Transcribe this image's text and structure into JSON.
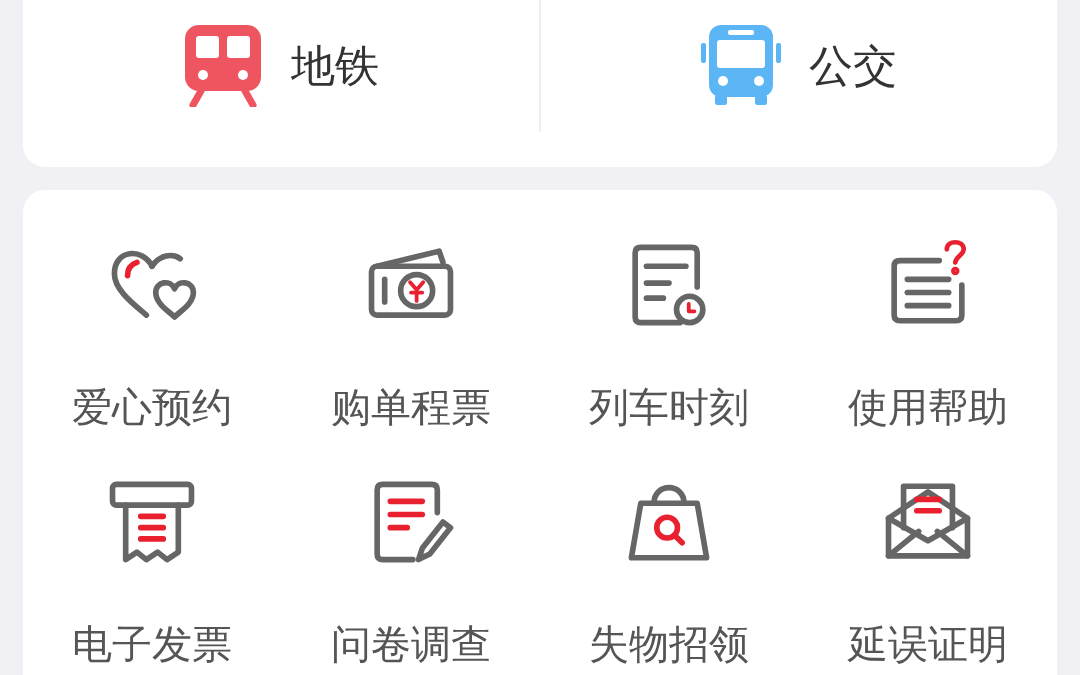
{
  "transport": [
    {
      "label": "地铁"
    },
    {
      "label": "公交"
    }
  ],
  "services": [
    {
      "label": "爱心预约"
    },
    {
      "label": "购单程票"
    },
    {
      "label": "列车时刻"
    },
    {
      "label": "使用帮助"
    },
    {
      "label": "电子发票"
    },
    {
      "label": "问卷调查"
    },
    {
      "label": "失物招领"
    },
    {
      "label": "延误证明"
    }
  ]
}
